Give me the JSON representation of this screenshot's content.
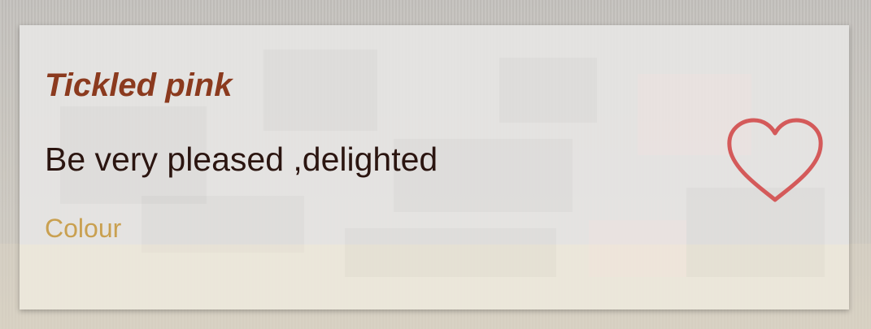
{
  "card": {
    "title": "Tickled pink",
    "meaning": "Be very pleased ,delighted",
    "category": "Colour",
    "favorite": false
  },
  "icons": {
    "favorite": "heart-outline-icon"
  },
  "colors": {
    "title": "#8b3a1e",
    "meaning": "#2b1510",
    "category": "#c9a050",
    "heart": "#d45a5a"
  }
}
